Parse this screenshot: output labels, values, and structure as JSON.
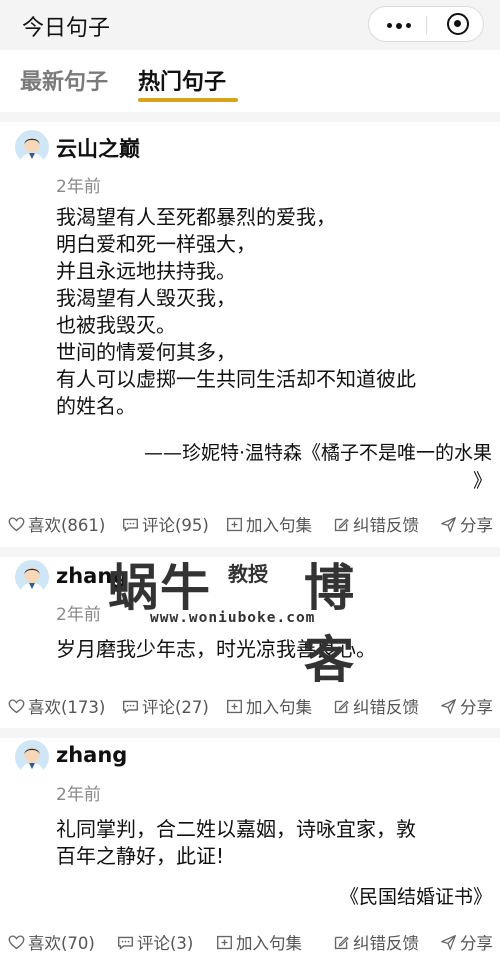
{
  "header": {
    "title": "今日句子"
  },
  "tabs": [
    {
      "label": "最新句子"
    },
    {
      "label": "热门句子"
    }
  ],
  "actions_labels": {
    "add": "加入句集",
    "report": "纠错反馈",
    "share": "分享"
  },
  "posts": [
    {
      "user": "云山之巅",
      "time": "2年前",
      "text": "我渴望有人至死都暴烈的爱我，\n明白爱和死一样强大，\n并且永远地扶持我。\n我渴望有人毁灭我，\n也被我毁灭。\n世间的情爱何其多，\n有人可以虚掷一生共同生活却不知道彼此\n的姓名。",
      "source_line1": "——珍妮特·温特森《橘子不是唯一的水果",
      "source_line2": "》",
      "likes": "喜欢(861)",
      "comments": "评论(95)"
    },
    {
      "user": "zhang",
      "time": "2年前",
      "text": "岁月磨我少年志，时光凉我善良心。",
      "likes": "喜欢(173)",
      "comments": "评论(27)"
    },
    {
      "user": "zhang",
      "time": "2年前",
      "text": "礼同掌判，合二姓以嘉姻，诗咏宜家，敦\n百年之静好，此证!",
      "source_line1": "《民国结婚证书》",
      "likes": "喜欢(70)",
      "comments": "评论(3)"
    }
  ],
  "watermark": {
    "text_a": "蜗牛",
    "text_b": "教授",
    "text_c": "博客",
    "url": "www.woniubokе.com"
  },
  "colors": {
    "accent": "#d9a21b",
    "muted": "#8a8a8a",
    "separator": "#f5f5f5"
  }
}
